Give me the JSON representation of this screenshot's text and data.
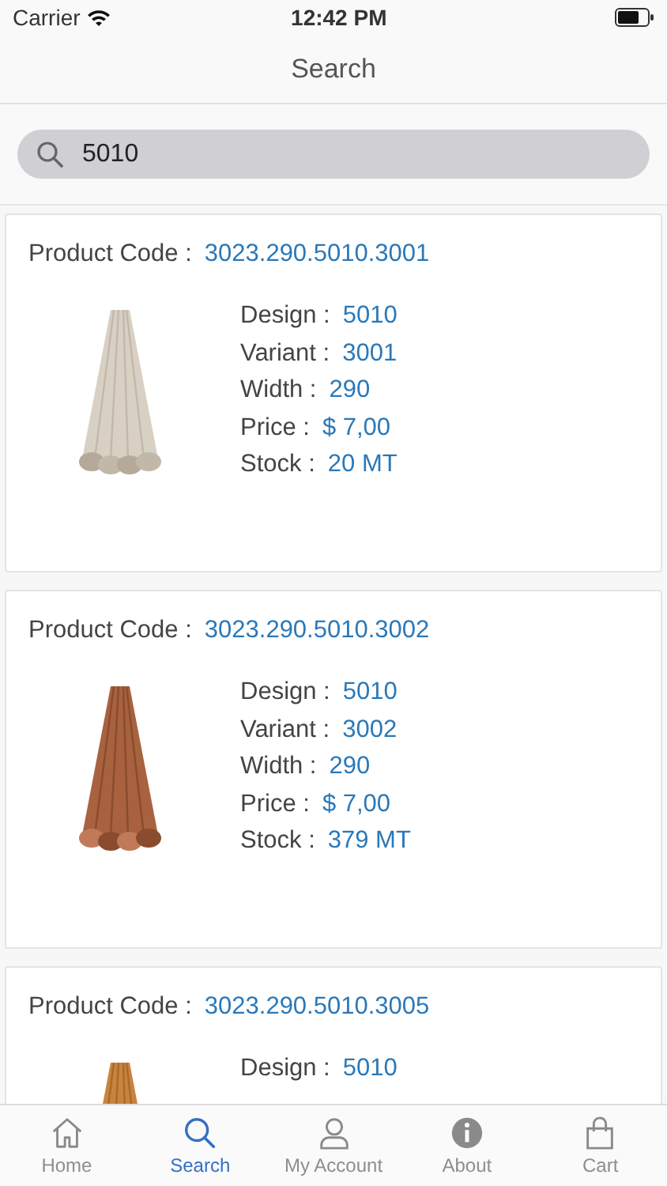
{
  "status_bar": {
    "carrier": "Carrier",
    "time": "12:42 PM"
  },
  "nav": {
    "title": "Search"
  },
  "search": {
    "value": "5010"
  },
  "products": [
    {
      "code_label": "Product Code :",
      "code": "3023.290.5010.3001",
      "details": [
        {
          "label": "Design :",
          "value": "5010"
        },
        {
          "label": "Variant :",
          "value": "3001"
        },
        {
          "label": "Width :",
          "value": "290"
        },
        {
          "label": "Price :",
          "value": "$ 7,00"
        },
        {
          "label": "Stock :",
          "value": "20 MT"
        }
      ]
    },
    {
      "code_label": "Product Code :",
      "code": "3023.290.5010.3002",
      "details": [
        {
          "label": "Design :",
          "value": "5010"
        },
        {
          "label": "Variant :",
          "value": "3002"
        },
        {
          "label": "Width :",
          "value": "290"
        },
        {
          "label": "Price :",
          "value": "$ 7,00"
        },
        {
          "label": "Stock :",
          "value": "379 MT"
        }
      ]
    },
    {
      "code_label": "Product Code :",
      "code": "3023.290.5010.3005",
      "details": [
        {
          "label": "Design :",
          "value": "5010"
        }
      ]
    }
  ],
  "tab_bar": [
    {
      "kind": "home",
      "label": "Home",
      "selected": false
    },
    {
      "kind": "search",
      "label": "Search",
      "selected": true
    },
    {
      "kind": "account",
      "label": "My Account",
      "selected": false
    },
    {
      "kind": "about",
      "label": "About",
      "selected": false
    },
    {
      "kind": "cart",
      "label": "Cart",
      "selected": false
    }
  ]
}
